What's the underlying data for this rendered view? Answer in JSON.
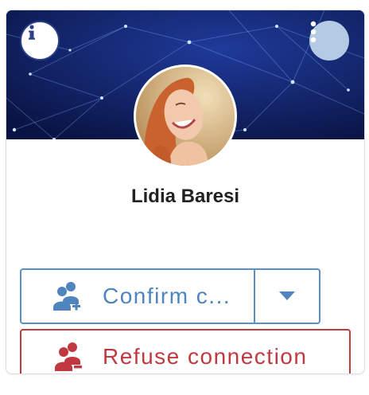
{
  "profile": {
    "name": "Lidia Baresi"
  },
  "actions": {
    "confirm_label": "Confirm c...",
    "refuse_label": "Refuse connection"
  },
  "icons": {
    "info": "info-icon",
    "more": "more-vertical-icon",
    "confirm": "user-plus-icon",
    "dropdown": "caret-down-icon",
    "refuse": "user-minus-icon"
  },
  "colors": {
    "banner": "#0e1c5a",
    "confirm_accent": "#4f84bf",
    "refuse_accent": "#c0393f",
    "more_button_bg": "#b4cbe3"
  }
}
